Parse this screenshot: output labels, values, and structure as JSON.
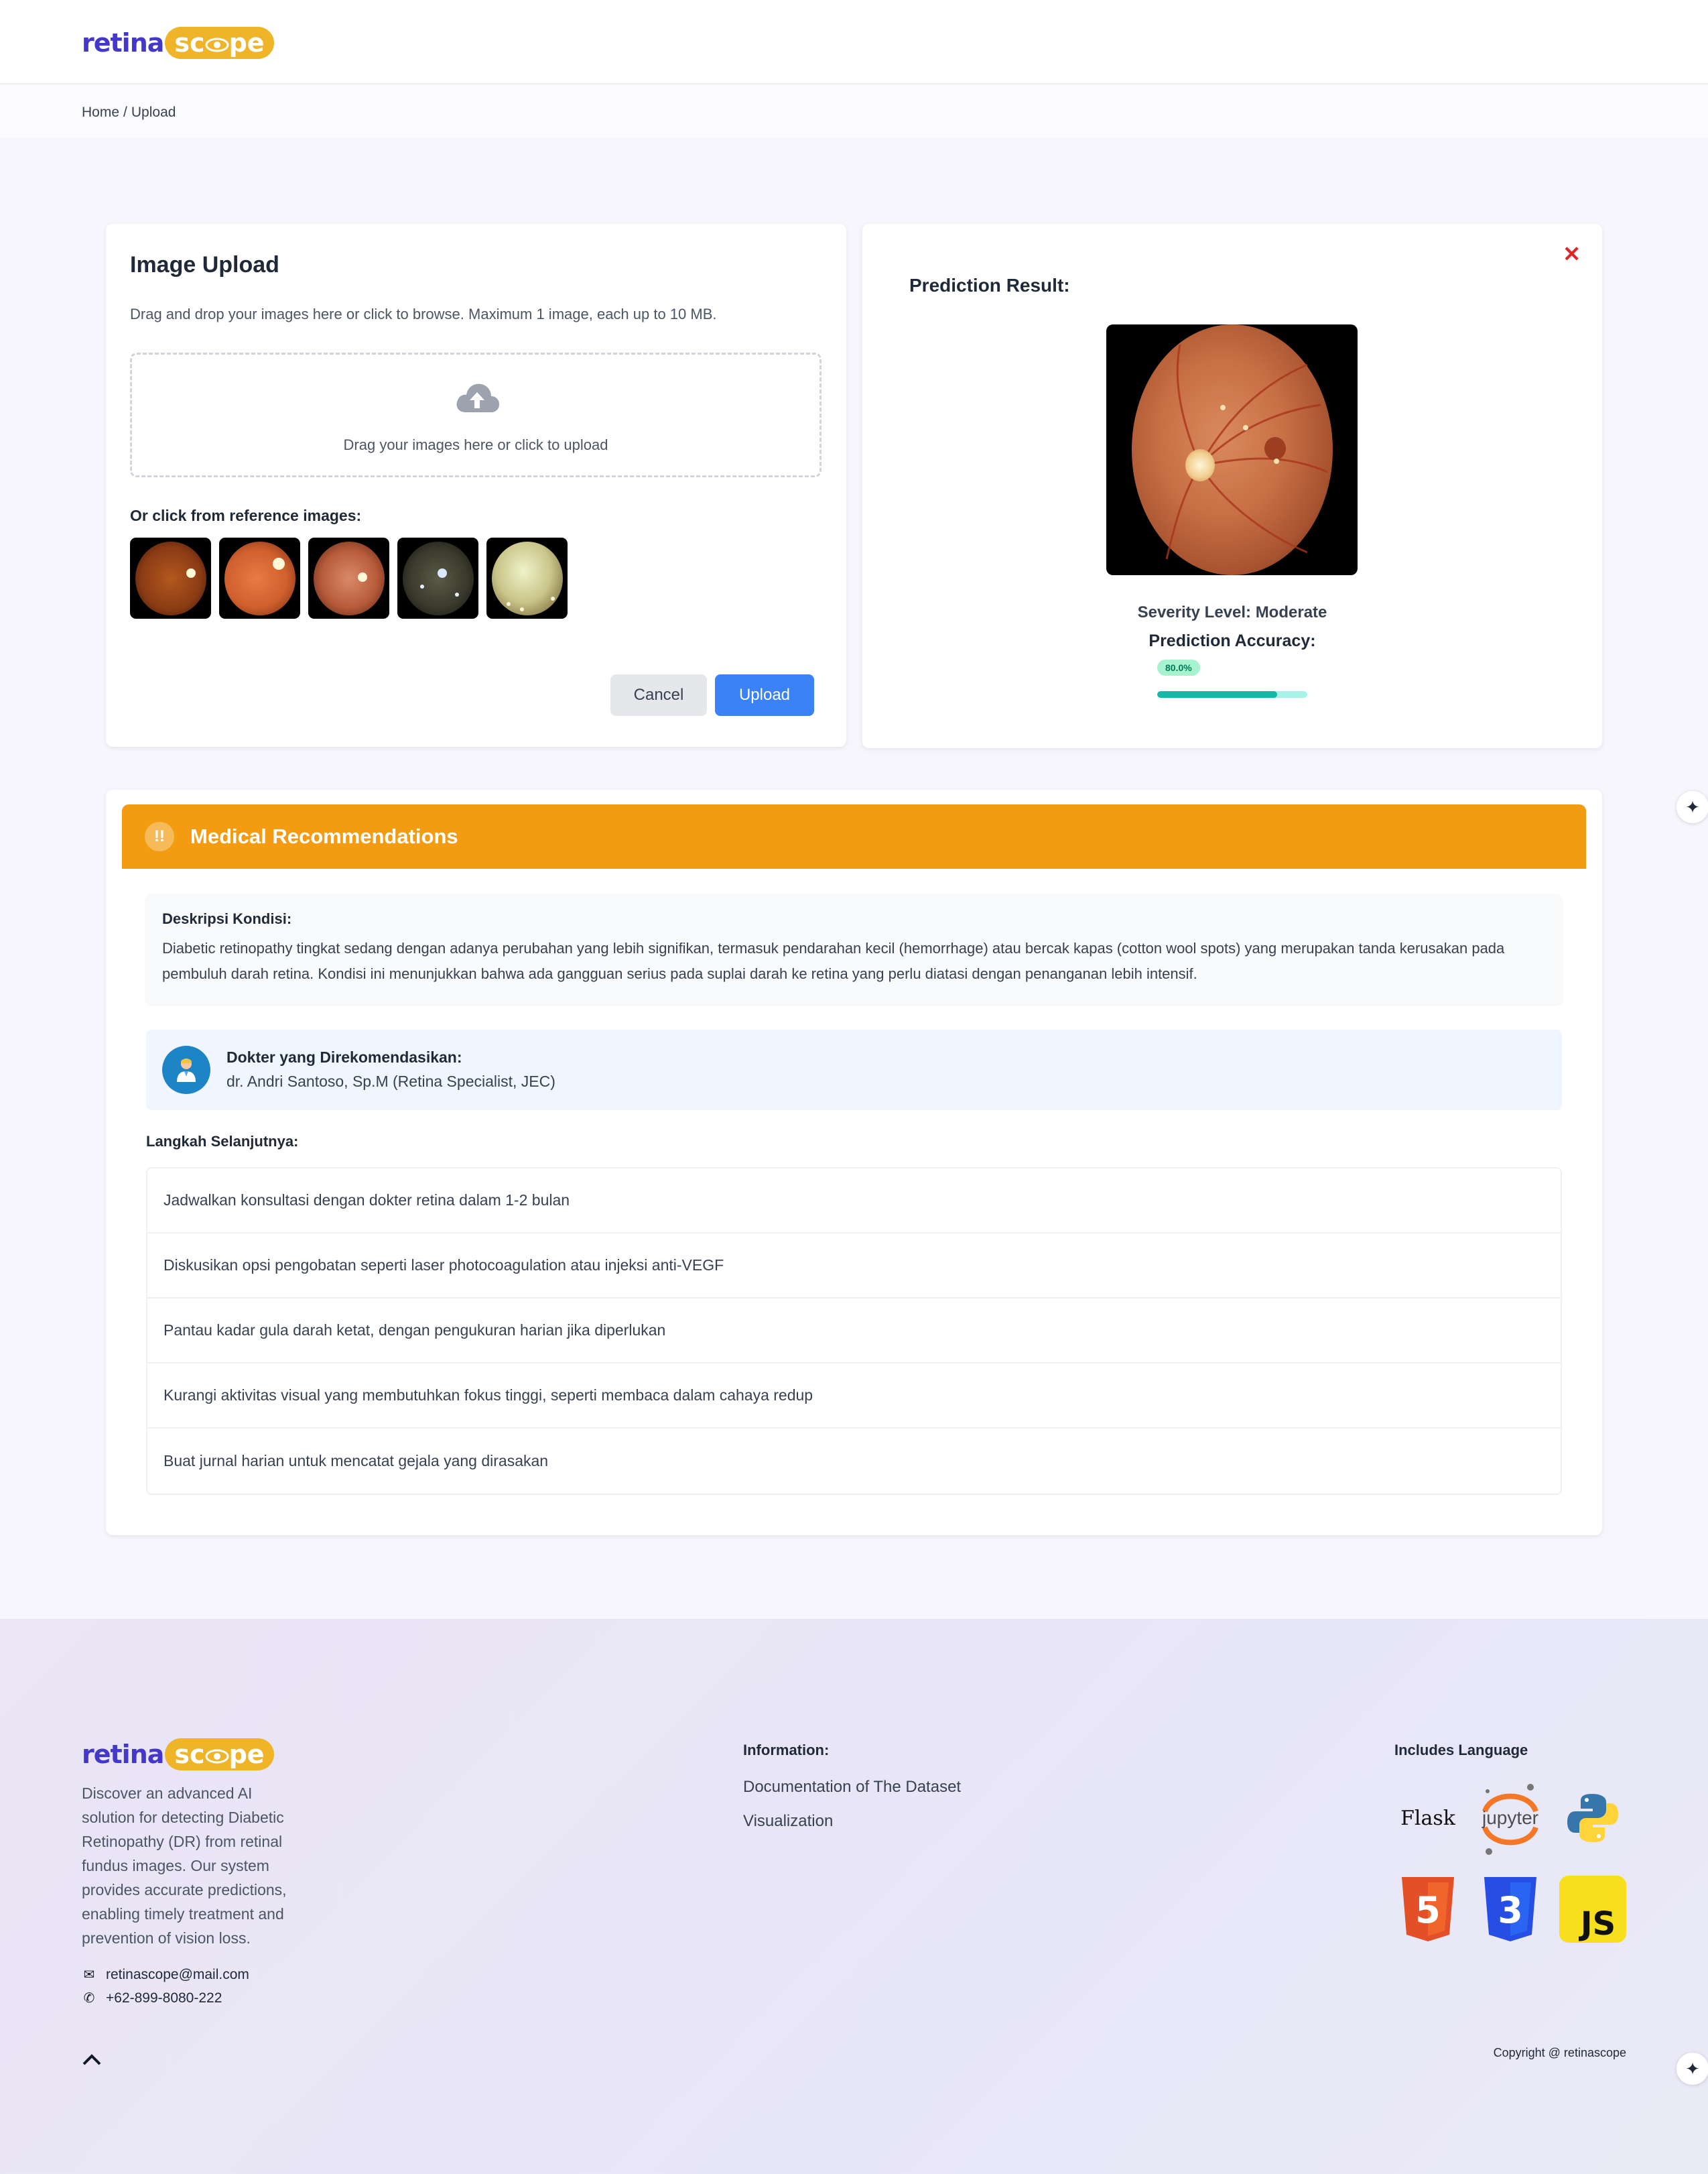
{
  "brand": {
    "part1": "retina",
    "part2": "sc",
    "part3": "pe",
    "logo_colors": {
      "primary": "#4338ca",
      "accent": "#f0b429"
    }
  },
  "breadcrumb": {
    "home": "Home",
    "separator": "/",
    "current": "Upload"
  },
  "upload": {
    "title": "Image Upload",
    "description": "Drag and drop your images here or click to browse. Maximum 1 image, each up to 10 MB.",
    "dropzone_text": "Drag your images here or click to upload",
    "dropzone_icon": "cloud-upload-icon",
    "reference_title": "Or click from reference images:",
    "cancel_label": "Cancel",
    "upload_label": "Upload"
  },
  "result": {
    "title": "Prediction Result:",
    "close_icon": "close-icon",
    "severity": "Severity Level: Moderate",
    "accuracy_label": "Prediction Accuracy:",
    "accuracy_text": "80.0%",
    "accuracy_value": 0.8,
    "colors": {
      "bar": "#14b8a6",
      "track": "#a7f3e7",
      "close": "#dc2626"
    }
  },
  "recommendations": {
    "title": "Medical Recommendations",
    "header_icon": "warning-icon",
    "header_icon_glyph": "!!",
    "header_color": "#f39c12",
    "description_label": "Deskripsi Kondisi:",
    "description": "Diabetic retinopathy tingkat sedang dengan adanya perubahan yang lebih signifikan, termasuk pendarahan kecil (hemorrhage) atau bercak kapas (cotton wool spots) yang merupakan tanda kerusakan pada pembuluh darah retina. Kondisi ini menunjukkan bahwa ada gangguan serius pada suplai darah ke retina yang perlu diatasi dengan penanganan lebih intensif.",
    "doctor_label": "Dokter yang Direkomendasikan:",
    "doctor_name": "dr. Andri Santoso, Sp.M (Retina Specialist, JEC)",
    "doctor_icon": "doctor-icon",
    "steps_title": "Langkah Selanjutnya:",
    "steps": [
      "Jadwalkan konsultasi dengan dokter retina dalam 1-2 bulan",
      "Diskusikan opsi pengobatan seperti laser photocoagulation atau injeksi anti-VEGF",
      "Pantau kadar gula darah ketat, dengan pengukuran harian jika diperlukan",
      "Kurangi aktivitas visual yang membutuhkan fokus tinggi, seperti membaca dalam cahaya redup",
      "Buat jurnal harian untuk mencatat gejala yang dirasakan"
    ]
  },
  "footer": {
    "about": "Discover an advanced AI solution for detecting Diabetic Retinopathy (DR) from retinal fundus images. Our system provides accurate predictions, enabling timely treatment and prevention of vision loss.",
    "email": "retinascope@mail.com",
    "phone": "+62-899-8080-222",
    "info_title": "Information:",
    "links": [
      "Documentation of The Dataset",
      "Visualization"
    ],
    "lang_title": "Includes Language",
    "languages": [
      {
        "name": "Flask",
        "icon": "flask-icon"
      },
      {
        "name": "jupyter",
        "icon": "jupyter-icon"
      },
      {
        "name": "Python",
        "icon": "python-icon"
      },
      {
        "name": "HTML5",
        "icon": "html5-icon",
        "glyph": "5"
      },
      {
        "name": "CSS3",
        "icon": "css3-icon",
        "glyph": "3"
      },
      {
        "name": "JavaScript",
        "icon": "javascript-icon",
        "glyph": "JS"
      }
    ],
    "copyright": "Copyright @ retinascope"
  }
}
